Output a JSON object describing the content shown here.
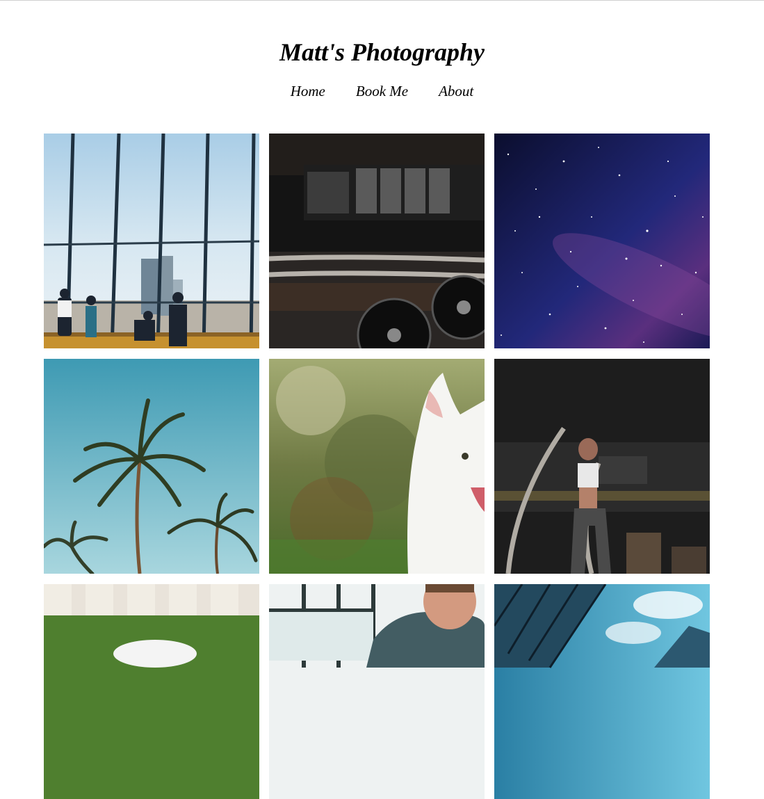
{
  "header": {
    "title": "Matt's Photography"
  },
  "nav": {
    "items": [
      "Home",
      "Book Me",
      "About"
    ]
  },
  "gallery": {
    "photos": [
      "office-windows-city-view",
      "gym-weights-rope",
      "starry-night-sky",
      "palm-trees-blue-sky",
      "white-dog-portrait",
      "woman-battle-ropes-gym",
      "white-picket-fence-grass",
      "man-plaid-shirt-window",
      "glass-skyscraper-sky"
    ]
  }
}
